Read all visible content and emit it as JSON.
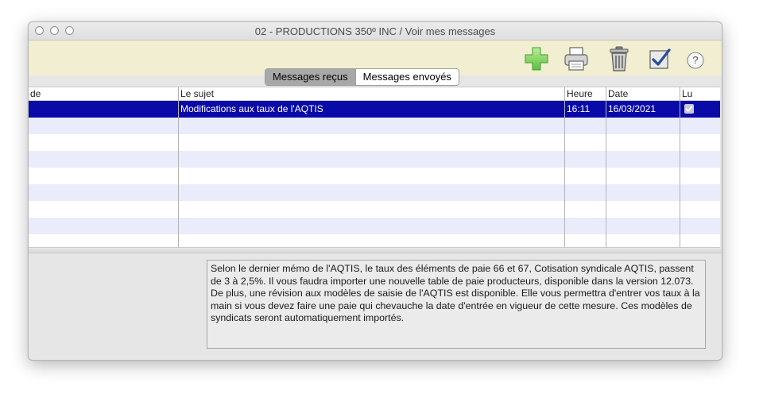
{
  "window": {
    "title": "02 - PRODUCTIONS 350º INC / Voir mes messages"
  },
  "toolbar": {
    "add_icon": "plus-icon",
    "print_icon": "printer-icon",
    "delete_icon": "trash-icon",
    "mark_read_icon": "checkbox-check-icon",
    "help_label": "?"
  },
  "tabs": {
    "received": "Messages reçus",
    "sent": "Messages envoyés"
  },
  "table": {
    "columns": {
      "from": "de",
      "subject": "Le sujet",
      "time": "Heure",
      "date": "Date",
      "read": "Lu"
    },
    "rows": [
      {
        "from": "",
        "subject": "Modifications aux taux de l'AQTIS",
        "time": "16:11",
        "date": "16/03/2021",
        "read": true
      }
    ]
  },
  "message": {
    "body": "Selon le dernier mémo de l'AQTIS, le taux des éléments de paie 66 et 67, Cotisation syndicale AQTIS, passent de 3 à 2,5%. Il vous faudra importer une nouvelle table de paie producteurs, disponible dans la version 12.073. De plus, une révision aux modèles de saisie de l'AQTIS est disponible. Elle vous permettra d'entrer vos taux à la main si vous devez faire une paie qui chevauche la date d'entrée en vigueur de cette mesure. Ces modèles de syndicats seront automatiquement importés."
  },
  "colors": {
    "selection": "#0a0aa8",
    "toolbar_bg": "#f1eed1",
    "stripe": "#eaecfb"
  }
}
